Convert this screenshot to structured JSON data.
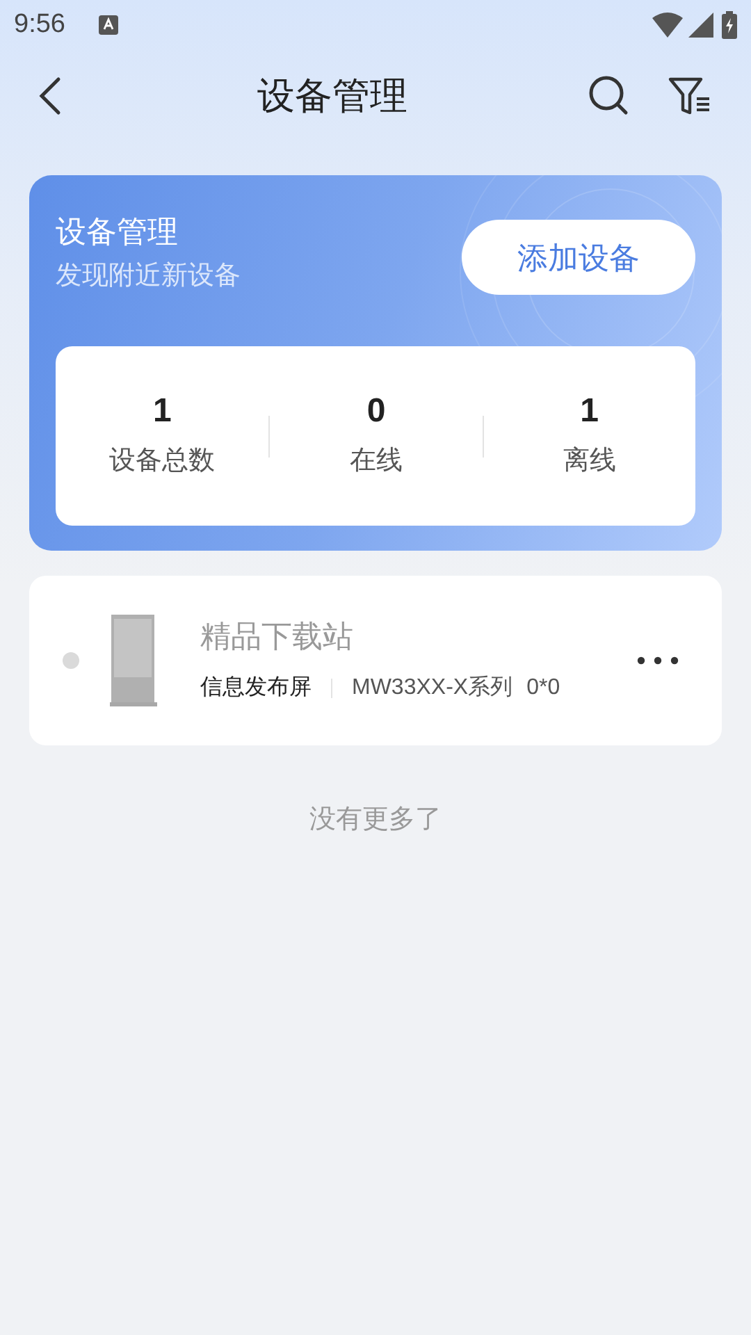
{
  "status_bar": {
    "time": "9:56"
  },
  "header": {
    "title": "设备管理"
  },
  "summary": {
    "title": "设备管理",
    "subtitle": "发现附近新设备",
    "add_button": "添加设备",
    "stats": [
      {
        "value": "1",
        "label": "设备总数"
      },
      {
        "value": "0",
        "label": "在线"
      },
      {
        "value": "1",
        "label": "离线"
      }
    ]
  },
  "devices": [
    {
      "name": "精品下载站",
      "type": "信息发布屏",
      "model": "MW33XX-X系列",
      "resolution": "0*0",
      "online": false
    }
  ],
  "footer": "没有更多了"
}
